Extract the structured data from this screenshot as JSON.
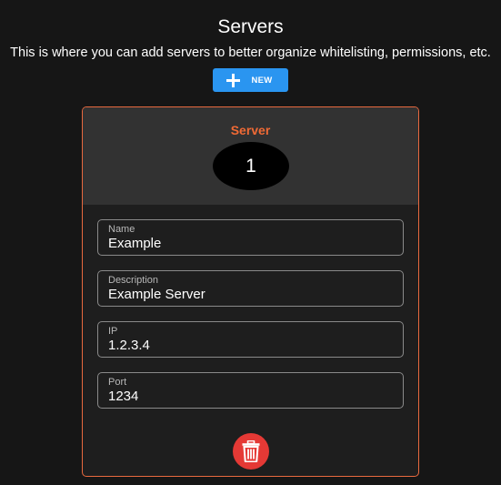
{
  "page": {
    "title": "Servers",
    "subtitle": "This is where you can add servers to better organize whitelisting, permissions, etc."
  },
  "toolbar": {
    "new_label": "NEW",
    "new_icon": "plus-icon",
    "accent_color": "#2a95f0"
  },
  "server_card": {
    "title": "Server",
    "title_color": "#f06a35",
    "border_color": "#e8693f",
    "number": "1",
    "fields": [
      {
        "label": "Name",
        "value": "Example"
      },
      {
        "label": "Description",
        "value": "Example Server"
      },
      {
        "label": "IP",
        "value": "1.2.3.4"
      },
      {
        "label": "Port",
        "value": "1234"
      }
    ],
    "delete_icon": "trash-icon",
    "delete_color": "#e53935"
  }
}
